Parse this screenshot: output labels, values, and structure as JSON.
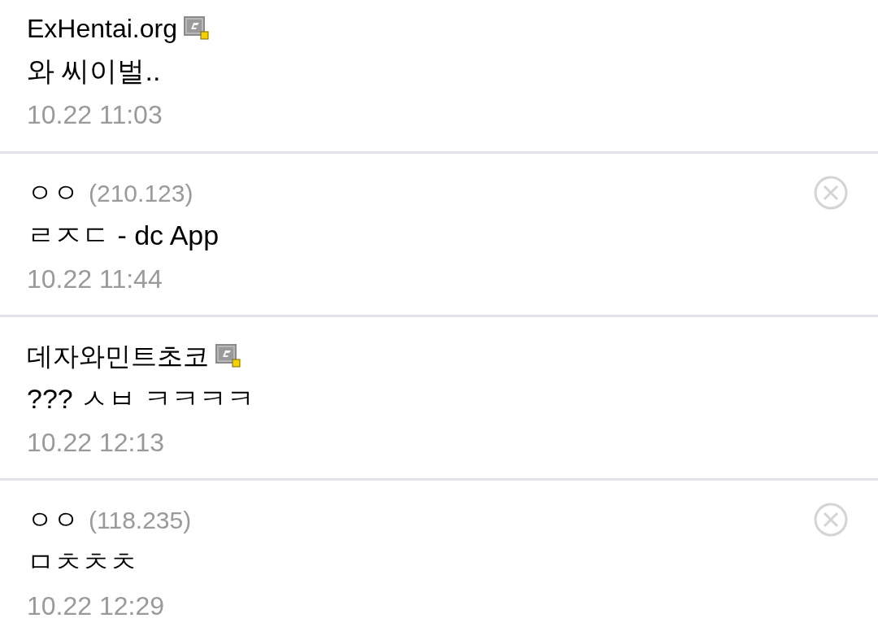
{
  "comments": [
    {
      "kind": "member",
      "author": "ExHentai.org",
      "text": "와 씨이벌..",
      "time": "10.22 11:03"
    },
    {
      "kind": "guest",
      "author": "ㅇㅇ",
      "ip": "(210.123)",
      "text": "ㄹㅈㄷ - dc App",
      "time": "10.22 11:44"
    },
    {
      "kind": "member",
      "author": "데자와민트초코",
      "text": "??? ㅅㅂ ㅋㅋㅋㅋ",
      "time": "10.22 12:13"
    },
    {
      "kind": "guest",
      "author": "ㅇㅇ",
      "ip": "(118.235)",
      "text": "ㅁㅊㅊㅊ",
      "time": "10.22 12:29"
    }
  ]
}
